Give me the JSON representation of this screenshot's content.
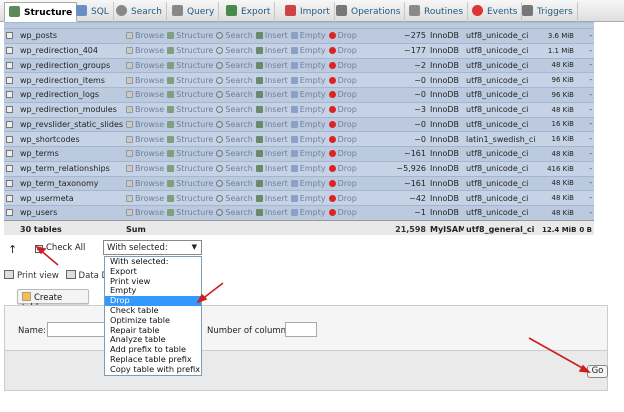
{
  "tabs": [
    {
      "label": "Structure",
      "icon": "structure-icon",
      "active": true
    },
    {
      "label": "SQL",
      "icon": "sql-icon"
    },
    {
      "label": "Search",
      "icon": "search-icon"
    },
    {
      "label": "Query",
      "icon": "query-icon"
    },
    {
      "label": "Export",
      "icon": "export-icon"
    },
    {
      "label": "Import",
      "icon": "import-icon"
    },
    {
      "label": "Operations",
      "icon": "wrench-icon"
    },
    {
      "label": "Routines",
      "icon": "routines-icon"
    },
    {
      "label": "Events",
      "icon": "clock-icon"
    },
    {
      "label": "Triggers",
      "icon": "triggers-icon"
    }
  ],
  "actions": {
    "browse": "Browse",
    "structure": "Structure",
    "search": "Search",
    "insert": "Insert",
    "empty": "Empty",
    "drop": "Drop"
  },
  "rows": [
    {
      "name": "wp_posts",
      "rows": "~275",
      "engine": "InnoDB",
      "collation": "utf8_unicode_ci",
      "size": "3.6 MiB",
      "overhead": "-"
    },
    {
      "name": "wp_redirection_404",
      "rows": "~177",
      "engine": "InnoDB",
      "collation": "utf8_unicode_ci",
      "size": "1.1 MiB",
      "overhead": "-"
    },
    {
      "name": "wp_redirection_groups",
      "rows": "~2",
      "engine": "InnoDB",
      "collation": "utf8_unicode_ci",
      "size": "48 KiB",
      "overhead": "-"
    },
    {
      "name": "wp_redirection_items",
      "rows": "~0",
      "engine": "InnoDB",
      "collation": "utf8_unicode_ci",
      "size": "96 KiB",
      "overhead": "-"
    },
    {
      "name": "wp_redirection_logs",
      "rows": "~0",
      "engine": "InnoDB",
      "collation": "utf8_unicode_ci",
      "size": "96 KiB",
      "overhead": "-"
    },
    {
      "name": "wp_redirection_modules",
      "rows": "~3",
      "engine": "InnoDB",
      "collation": "utf8_unicode_ci",
      "size": "48 KiB",
      "overhead": "-"
    },
    {
      "name": "wp_revslider_static_slides",
      "rows": "~0",
      "engine": "InnoDB",
      "collation": "utf8_unicode_ci",
      "size": "16 KiB",
      "overhead": "-"
    },
    {
      "name": "wp_shortcodes",
      "rows": "~0",
      "engine": "InnoDB",
      "collation": "latin1_swedish_ci",
      "size": "16 KiB",
      "overhead": "-"
    },
    {
      "name": "wp_terms",
      "rows": "~161",
      "engine": "InnoDB",
      "collation": "utf8_unicode_ci",
      "size": "48 KiB",
      "overhead": "-"
    },
    {
      "name": "wp_term_relationships",
      "rows": "~5,926",
      "engine": "InnoDB",
      "collation": "utf8_unicode_ci",
      "size": "416 KiB",
      "overhead": "-"
    },
    {
      "name": "wp_term_taxonomy",
      "rows": "~161",
      "engine": "InnoDB",
      "collation": "utf8_unicode_ci",
      "size": "48 KiB",
      "overhead": "-"
    },
    {
      "name": "wp_usermeta",
      "rows": "~42",
      "engine": "InnoDB",
      "collation": "utf8_unicode_ci",
      "size": "48 KiB",
      "overhead": "-"
    },
    {
      "name": "wp_users",
      "rows": "~1",
      "engine": "InnoDB",
      "collation": "utf8_unicode_ci",
      "size": "48 KiB",
      "overhead": "-"
    }
  ],
  "footer": {
    "count": "30 tables",
    "sum": "Sum",
    "rows": "21,598",
    "engine": "MyISAM",
    "collation": "utf8_general_ci",
    "size": "12.4 MiB",
    "overhead": "0 B"
  },
  "bottom": {
    "check_all": "Check All",
    "with_selected": "With selected:",
    "options": [
      "With selected:",
      "Export",
      "Print view",
      "Empty",
      "Drop",
      "Check table",
      "Optimize table",
      "Repair table",
      "Analyze table",
      "Add prefix to table",
      "Replace table prefix",
      "Copy table with prefix"
    ],
    "highlighted_option": "Drop",
    "print_view": "Print view",
    "data_dict": "Data Dict",
    "create_table": "Create table",
    "name_label": "Name:",
    "columns_label": "Number of columns:",
    "go": "Go"
  },
  "colors": {
    "row": "#bccae0",
    "highlight": "#3399ff",
    "arrow": "#cc1f1f"
  }
}
